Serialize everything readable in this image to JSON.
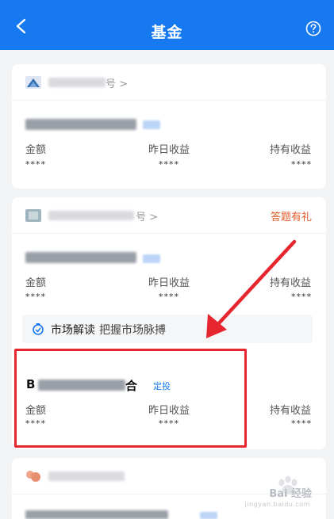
{
  "header": {
    "title": "基金",
    "back_icon": "chevron-left-icon",
    "help_icon": "question-circle-icon"
  },
  "colors": {
    "brand": "#1779f0",
    "accent_link": "#e25b2a",
    "annotation": "#e6262e"
  },
  "cards": [
    {
      "head_suffix": "号 >",
      "funds": [
        {
          "labels": [
            "金额",
            "昨日收益",
            "持有收益"
          ],
          "values": [
            "****",
            "****",
            "****"
          ]
        }
      ]
    },
    {
      "head_suffix": "号 >",
      "head_link": "答题有礼",
      "funds": [
        {
          "labels": [
            "金额",
            "昨日收益",
            "持有收益"
          ],
          "values": [
            "****",
            "****",
            "****"
          ]
        },
        {
          "name_lead": "B",
          "name_tail": "合",
          "tag": "定投",
          "labels": [
            "金额",
            "昨日收益",
            "持有收益"
          ],
          "values": [
            "****",
            "****",
            "****"
          ]
        }
      ],
      "insight": {
        "title": "市场解读",
        "subtitle": "把握市场脉搏"
      }
    }
  ],
  "watermark": {
    "text": "Bai 经验",
    "sub": "jingyan.baidu.com"
  }
}
